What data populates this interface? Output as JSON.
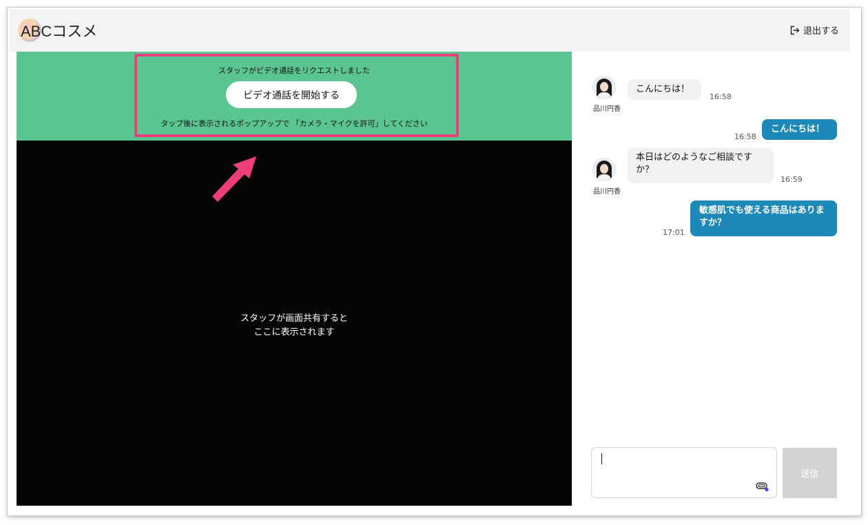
{
  "header": {
    "logo_text": "ABCコスメ",
    "logout_label": "退出する"
  },
  "banner": {
    "request_message": "スタッフがビデオ通話をリクエストしました",
    "start_button_label": "ビデオ通話を開始する",
    "permission_note": "タップ後に表示されるポップアップで 「カメラ・マイクを許可」してください"
  },
  "screen_share": {
    "placeholder": "スタッフが画面共有すると\nここに表示されます"
  },
  "chat": {
    "messages": [
      {
        "direction": "incoming",
        "sender": "品川円香",
        "text": "こんにちは！",
        "time": "16:58"
      },
      {
        "direction": "outgoing",
        "text": "こんにちは！",
        "time": "16:58"
      },
      {
        "direction": "incoming",
        "sender": "品川円香",
        "text": "本日はどのようなご相談ですか？",
        "time": "16:59"
      },
      {
        "direction": "outgoing",
        "text": "敏感肌でも使える商品はありますか？",
        "time": "17:01"
      }
    ],
    "input_value": "",
    "send_label": "送信"
  },
  "icons": {
    "logout": "logout-icon",
    "attachment": "paperclip-icon",
    "annotation": "pink-arrow"
  },
  "colors": {
    "banner": "#5bc591",
    "highlight": "#ee3f7a",
    "outgoing_bubble": "#1e88b8"
  }
}
